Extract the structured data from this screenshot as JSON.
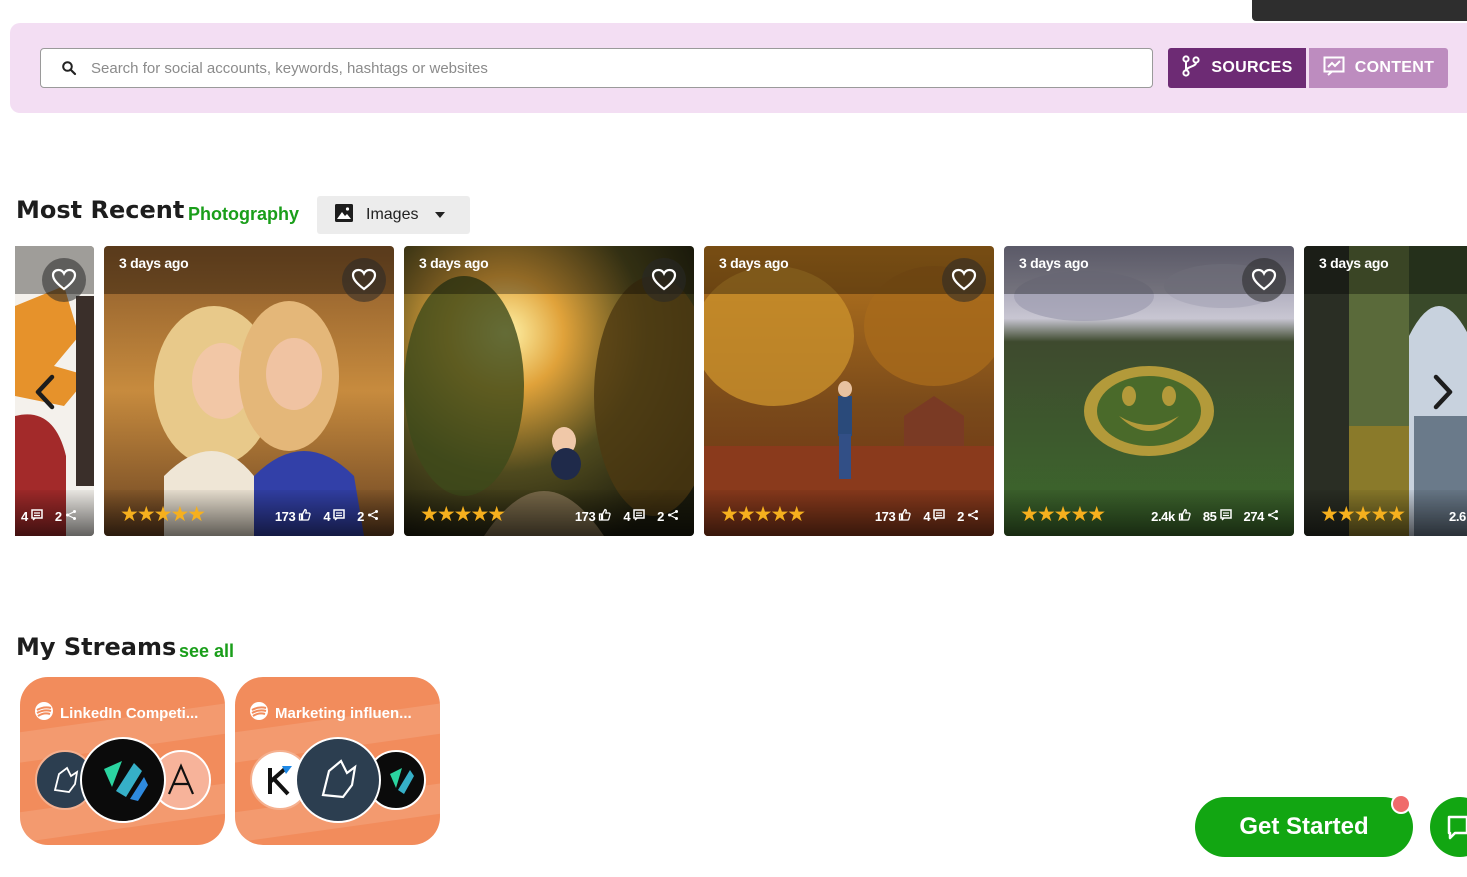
{
  "search": {
    "placeholder": "Search for social accounts, keywords, hashtags or websites",
    "value": ""
  },
  "toggle": {
    "sources_label": "SOURCES",
    "content_label": "CONTENT"
  },
  "most_recent": {
    "title": "Most Recent",
    "category": "Photography",
    "filter_label": "Images"
  },
  "cards": [
    {
      "age": "",
      "stars": "★★★★★",
      "likes": "",
      "comments": "4",
      "shares": "2"
    },
    {
      "age": "3 days ago",
      "stars": "★★★★★",
      "likes": "173",
      "comments": "4",
      "shares": "2"
    },
    {
      "age": "3 days ago",
      "stars": "★★★★★",
      "likes": "173",
      "comments": "4",
      "shares": "2"
    },
    {
      "age": "3 days ago",
      "stars": "★★★★★",
      "likes": "173",
      "comments": "4",
      "shares": "2"
    },
    {
      "age": "3 days ago",
      "stars": "★★★★★",
      "likes": "2.4k",
      "comments": "85",
      "shares": "274"
    },
    {
      "age": "3 days ago",
      "stars": "★★★★★",
      "likes": "2.6",
      "comments": "",
      "shares": ""
    }
  ],
  "my_streams": {
    "title": "My Streams",
    "see_all": "see all",
    "items": [
      {
        "title": "LinkedIn Competi..."
      },
      {
        "title": "Marketing influen..."
      }
    ]
  },
  "cta": {
    "label": "Get Started"
  },
  "colors": {
    "brand_purple": "#6d2b74",
    "light_purple": "#bd8cbf",
    "band": "#f3def3",
    "green": "#12a612",
    "star": "#f6b01e",
    "stream_orange": "#f28c5c"
  }
}
